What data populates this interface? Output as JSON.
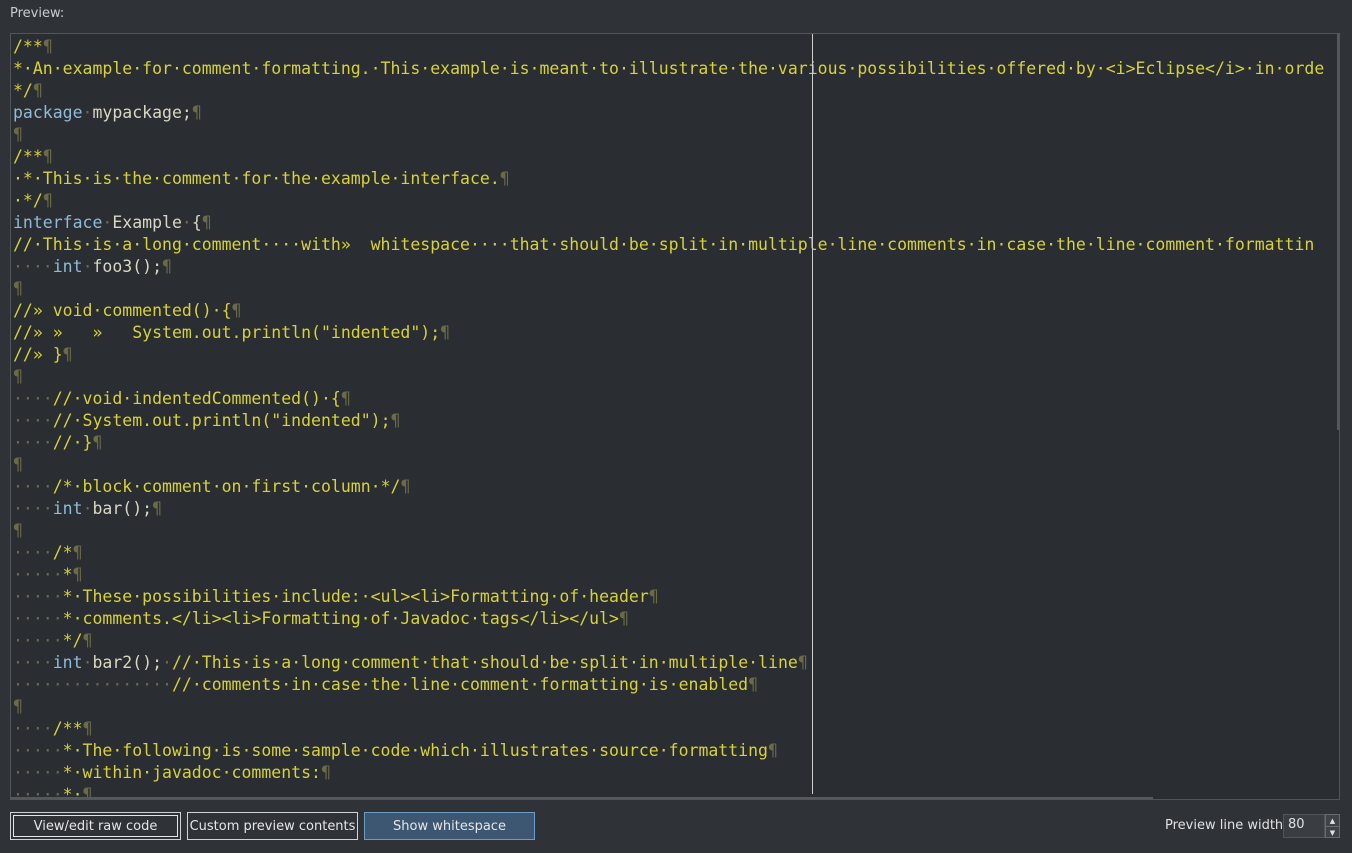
{
  "preview_label": "Preview:",
  "buttons": {
    "view_edit_raw": "View/edit raw code",
    "custom_preview": "Custom preview contents",
    "show_whitespace": "Show whitespace"
  },
  "line_width": {
    "label": "Preview line width:",
    "value": "80"
  },
  "code_lines": [
    [
      [
        "c",
        "/**"
      ],
      [
        "ws",
        "¶"
      ]
    ],
    [
      [
        "c",
        "*·An·example·for·comment·formatting.·This·example·is·meant·to·illustrate·the·various·possibilities·offered·by·<i>Eclipse</i>·in·orde"
      ]
    ],
    [
      [
        "c",
        "*/"
      ],
      [
        "ws",
        "¶"
      ]
    ],
    [
      [
        "k",
        "package"
      ],
      [
        "ws",
        "·"
      ],
      [
        "t",
        "mypackage;"
      ],
      [
        "ws",
        "¶"
      ]
    ],
    [
      [
        "ws",
        "¶"
      ]
    ],
    [
      [
        "c",
        "/**"
      ],
      [
        "ws",
        "¶"
      ]
    ],
    [
      [
        "c",
        "·*·This·is·the·comment·for·the·example·interface."
      ],
      [
        "ws",
        "¶"
      ]
    ],
    [
      [
        "c",
        "·*/"
      ],
      [
        "ws",
        "¶"
      ]
    ],
    [
      [
        "k",
        "interface"
      ],
      [
        "ws",
        "·"
      ],
      [
        "t",
        "Example"
      ],
      [
        "ws",
        "·"
      ],
      [
        "t",
        "{"
      ],
      [
        "ws",
        "¶"
      ]
    ],
    [
      [
        "c",
        "//·This·is·a·long·comment····with»  whitespace····that·should·be·split·in·multiple·line·comments·in·case·the·line·comment·formattin"
      ]
    ],
    [
      [
        "ws",
        "····"
      ],
      [
        "k",
        "int"
      ],
      [
        "ws",
        "·"
      ],
      [
        "t",
        "foo3();"
      ],
      [
        "ws",
        "¶"
      ]
    ],
    [
      [
        "ws",
        "¶"
      ]
    ],
    [
      [
        "c",
        "//» void·commented()·{"
      ],
      [
        "ws",
        "¶"
      ]
    ],
    [
      [
        "c",
        "//» »   »   System.out.println(\"indented\");"
      ],
      [
        "ws",
        "¶"
      ]
    ],
    [
      [
        "c",
        "//» }"
      ],
      [
        "ws",
        "¶"
      ]
    ],
    [
      [
        "ws",
        "¶"
      ]
    ],
    [
      [
        "ws",
        "····"
      ],
      [
        "c",
        "//·void·indentedCommented()·{"
      ],
      [
        "ws",
        "¶"
      ]
    ],
    [
      [
        "ws",
        "····"
      ],
      [
        "c",
        "//·System.out.println(\"indented\");"
      ],
      [
        "ws",
        "¶"
      ]
    ],
    [
      [
        "ws",
        "····"
      ],
      [
        "c",
        "//·}"
      ],
      [
        "ws",
        "¶"
      ]
    ],
    [
      [
        "ws",
        "¶"
      ]
    ],
    [
      [
        "ws",
        "····"
      ],
      [
        "c",
        "/*·block·comment·on·first·column·*/"
      ],
      [
        "ws",
        "¶"
      ]
    ],
    [
      [
        "ws",
        "····"
      ],
      [
        "k",
        "int"
      ],
      [
        "ws",
        "·"
      ],
      [
        "t",
        "bar();"
      ],
      [
        "ws",
        "¶"
      ]
    ],
    [
      [
        "ws",
        "¶"
      ]
    ],
    [
      [
        "ws",
        "····"
      ],
      [
        "c",
        "/*"
      ],
      [
        "ws",
        "¶"
      ]
    ],
    [
      [
        "ws",
        "·····"
      ],
      [
        "c",
        "*"
      ],
      [
        "ws",
        "¶"
      ]
    ],
    [
      [
        "ws",
        "·····"
      ],
      [
        "c",
        "*·These·possibilities·include:·<ul><li>Formatting·of·header"
      ],
      [
        "ws",
        "¶"
      ]
    ],
    [
      [
        "ws",
        "·····"
      ],
      [
        "c",
        "*·comments.</li><li>Formatting·of·Javadoc·tags</li></ul>"
      ],
      [
        "ws",
        "¶"
      ]
    ],
    [
      [
        "ws",
        "·····"
      ],
      [
        "c",
        "*/"
      ],
      [
        "ws",
        "¶"
      ]
    ],
    [
      [
        "ws",
        "····"
      ],
      [
        "k",
        "int"
      ],
      [
        "ws",
        "·"
      ],
      [
        "t",
        "bar2();"
      ],
      [
        "ws",
        "·"
      ],
      [
        "c",
        "//·This·is·a·long·comment·that·should·be·split·in·multiple·line"
      ],
      [
        "ws",
        "¶"
      ]
    ],
    [
      [
        "ws",
        "················"
      ],
      [
        "c",
        "//·comments·in·case·the·line·comment·formatting·is·enabled"
      ],
      [
        "ws",
        "¶"
      ]
    ],
    [
      [
        "ws",
        "¶"
      ]
    ],
    [
      [
        "ws",
        "····"
      ],
      [
        "c",
        "/**"
      ],
      [
        "ws",
        "¶"
      ]
    ],
    [
      [
        "ws",
        "·····"
      ],
      [
        "c",
        "*·The·following·is·some·sample·code·which·illustrates·source·formatting"
      ],
      [
        "ws",
        "¶"
      ]
    ],
    [
      [
        "ws",
        "·····"
      ],
      [
        "c",
        "*·within·javadoc·comments:"
      ],
      [
        "ws",
        "¶"
      ]
    ],
    [
      [
        "ws",
        "·····"
      ],
      [
        "c",
        "*·"
      ],
      [
        "ws",
        "¶"
      ]
    ]
  ]
}
